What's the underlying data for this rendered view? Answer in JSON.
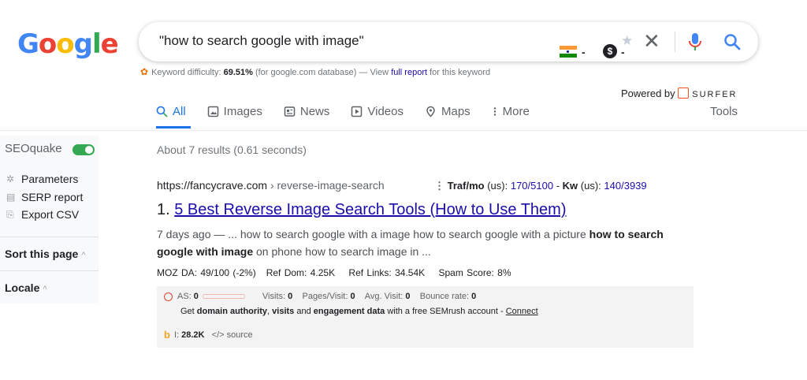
{
  "logo": {
    "letters": [
      "G",
      "o",
      "o",
      "g",
      "l",
      "e"
    ],
    "colors": [
      "#4285f4",
      "#ea4335",
      "#fbbc05",
      "#4285f4",
      "#34a853",
      "#ea4335"
    ]
  },
  "search": {
    "query": "\"how to search google with image\"",
    "flag_dash": "-",
    "coin_symbol": "$",
    "coin_dash": "-"
  },
  "keyword_bar": {
    "label": "Keyword difficulty:",
    "value": "69.51%",
    "db_note": "(for google.com database) — View",
    "link": "full report",
    "suffix": "for this keyword"
  },
  "powered": {
    "text": "Powered by",
    "brand": "SURFER"
  },
  "tabs": [
    {
      "label": "All",
      "icon": "search-icon"
    },
    {
      "label": "Images",
      "icon": "image-icon"
    },
    {
      "label": "News",
      "icon": "news-icon"
    },
    {
      "label": "Videos",
      "icon": "video-icon"
    },
    {
      "label": "Maps",
      "icon": "map-pin-icon"
    },
    {
      "label": "More",
      "icon": "kebab-icon"
    }
  ],
  "tools_label": "Tools",
  "sidebar": {
    "title": "SEOquake",
    "items": [
      "Parameters",
      "SERP report",
      "Export CSV"
    ],
    "sort_label": "Sort this page",
    "locale_label": "Locale"
  },
  "stats": "About 7 results (0.61 seconds)",
  "result": {
    "url_host": "https://fancycrave.com",
    "url_path": " › reverse-image-search",
    "traf_label": "Traf/mo",
    "traf_region": "(us):",
    "traf_value": "170/5100",
    "kw_label": "Kw",
    "kw_region": "(us):",
    "kw_value": "140/3939",
    "number": "1.",
    "title": "5 Best Reverse Image Search Tools (How to Use Them)",
    "snippet_pre": "7 days ago — ... how to search google with a image how to search google with a picture ",
    "snippet_bold1": "how to search google with image",
    "snippet_post": " on phone how to search image in ...",
    "moz": "MOZ DA: 49/100 (-2%)   Ref Dom: 4.25K    Ref Links: 34.54K    Spam Score: 8%"
  },
  "semrush": {
    "as_label": "AS:",
    "as_value": "0",
    "visits_label": "Visits:",
    "visits_value": "0",
    "ppv_label": "Pages/Visit:",
    "ppv_value": "0",
    "avg_label": "Avg. Visit:",
    "avg_value": "0",
    "bounce_label": "Bounce rate:",
    "bounce_value": "0",
    "get": "Get",
    "b1": "domain authority",
    "comma": ",",
    "b2": "visits",
    "and": "and",
    "b3": "engagement data",
    "tail": "with a free SEMrush account -",
    "connect": "Connect",
    "bing_label": "I:",
    "bing_value": "28.2K",
    "source_icon": "</>",
    "source": "source"
  }
}
